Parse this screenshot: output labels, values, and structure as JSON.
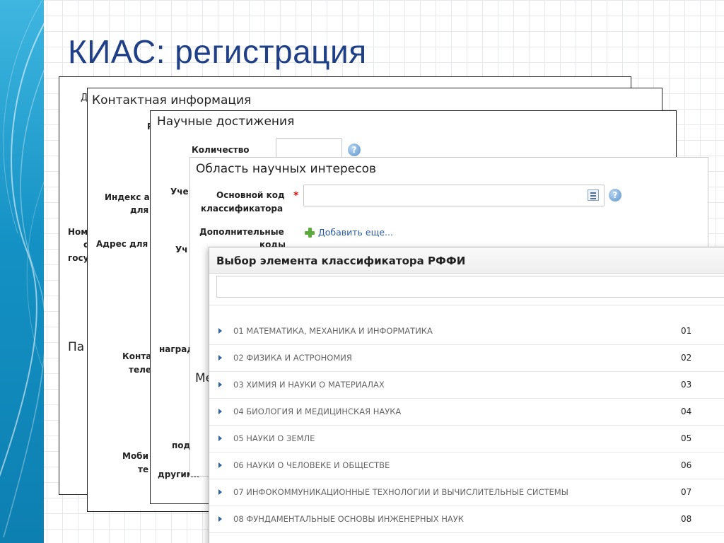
{
  "slide": {
    "title": "КИАС: регистрация"
  },
  "panels": {
    "p1": {
      "title_fragment": "Д",
      "labels": [
        "Ном",
        "с",
        "госу"
      ],
      "bottom_text": "Па"
    },
    "p2": {
      "title": "Контактная информация",
      "labels": {
        "r": "Р",
        "index_1": "Индекс а",
        "index_2": "для",
        "address": "Адрес для",
        "contact_1": "Конта",
        "contact_2": "теле",
        "mobile_1": "Моби",
        "mobile_2": "те"
      }
    },
    "p3": {
      "title": "Научные достижения",
      "labels": {
        "count": "Количество",
        "uch1": "Уче",
        "uch2": "Уч",
        "k": "К",
        "a": "а",
        "nagrad": "наград",
        "pod": "под",
        "drugimi": "другими"
      }
    },
    "p4": {
      "title": "Область научных интересов",
      "main_code_label_1": "Основной код",
      "main_code_label_2": "классификатора",
      "additional_label_1": "Дополнительные",
      "additional_label_2": "коды",
      "add_more": "Добавить еще...",
      "me": "Ме"
    }
  },
  "modal": {
    "title": "Выбор элемента классификатора РФФИ",
    "search_value": "",
    "rows": [
      {
        "name": "01 МАТЕМАТИКА, МЕХАНИКА И ИНФОРМАТИКА",
        "code": "01"
      },
      {
        "name": "02 ФИЗИКА И АСТРОНОМИЯ",
        "code": "02"
      },
      {
        "name": "03 ХИМИЯ И НАУКИ О МАТЕРИАЛАХ",
        "code": "03"
      },
      {
        "name": "04 БИОЛОГИЯ И МЕДИЦИНСКАЯ НАУКА",
        "code": "04"
      },
      {
        "name": "05 НАУКИ О ЗЕМЛЕ",
        "code": "05"
      },
      {
        "name": "06 НАУКИ О ЧЕЛОВЕКЕ И ОБЩЕСТВЕ",
        "code": "06"
      },
      {
        "name": "07 ИНФОКОММУНИКАЦИОННЫЕ ТЕХНОЛОГИИ И ВЫЧИСЛИТЕЛЬНЫЕ СИСТЕМЫ",
        "code": "07"
      },
      {
        "name": "08 ФУНДАМЕНТАЛЬНЫЕ ОСНОВЫ ИНЖЕНЕРНЫХ НАУК",
        "code": "08"
      }
    ]
  },
  "colors": {
    "title": "#1f3f86",
    "strip": "#1491c4",
    "link": "#2a5aa8",
    "required": "#cc1111",
    "tree_arrow": "#2f62a3"
  }
}
